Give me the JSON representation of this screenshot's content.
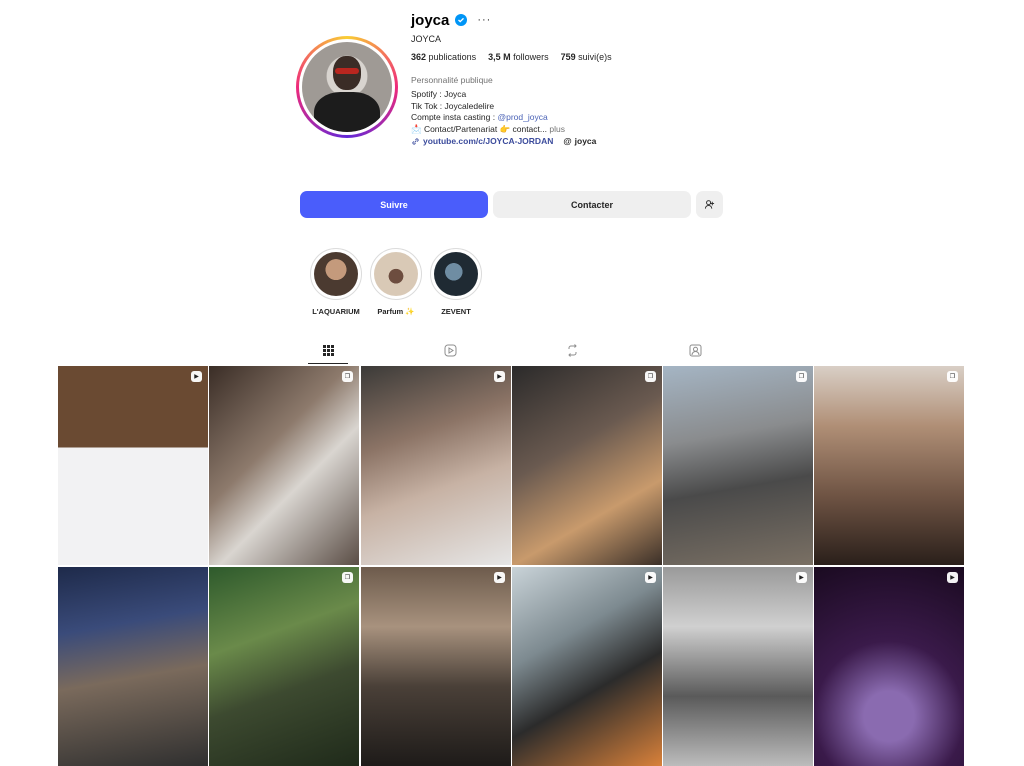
{
  "profile": {
    "username": "joyca",
    "verified_icon": "verified-badge-icon",
    "more_glyph": "···",
    "full_name": "JOYCA",
    "stats": [
      {
        "value": "362",
        "label": "publications"
      },
      {
        "value": "3,5 M",
        "label": "followers"
      },
      {
        "value": "759",
        "label": "suivi(e)s"
      }
    ],
    "category": "Personnalité publique",
    "bio": {
      "line1": "Spotify : Joyca",
      "line2": "Tik Tok : Joycaledelire",
      "line3_prefix": "Compte insta casting : ",
      "line3_mention": "@prod_joyca",
      "line4": "📩 Contact/Partenariat 👉 contact...",
      "line4_more": " plus"
    },
    "link": "youtube.com/c/JOYCA-JORDAN",
    "threads": "joyca"
  },
  "actions": {
    "follow": "Suivre",
    "contact": "Contacter",
    "add_user_icon": "add-user-icon"
  },
  "highlights": [
    {
      "label": "L'AQUARIUM"
    },
    {
      "label": "Parfum ✨"
    },
    {
      "label": "ZEVENT"
    }
  ],
  "tabs": [
    {
      "icon": "grid-icon",
      "glyph": "▦"
    },
    {
      "icon": "reels-icon",
      "glyph": "▷"
    },
    {
      "icon": "reposts-icon",
      "glyph": "⟲"
    },
    {
      "icon": "tagged-icon",
      "glyph": "◉"
    }
  ],
  "colors": {
    "accent": "#4a5dfb",
    "link": "#3b4b9c",
    "verified": "#0095f6"
  }
}
